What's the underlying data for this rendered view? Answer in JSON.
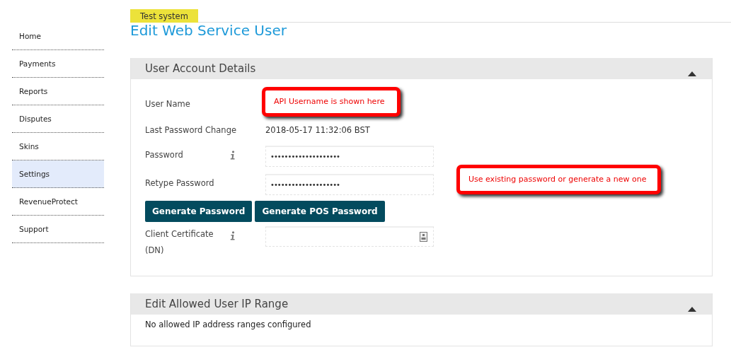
{
  "sidebar": {
    "items": [
      {
        "label": "Home",
        "selected": false
      },
      {
        "label": "Payments",
        "selected": false
      },
      {
        "label": "Reports",
        "selected": false
      },
      {
        "label": "Disputes",
        "selected": false
      },
      {
        "label": "Skins",
        "selected": false
      },
      {
        "label": "Settings",
        "selected": true
      },
      {
        "label": "RevenueProtect",
        "selected": false
      },
      {
        "label": "Support",
        "selected": false
      }
    ]
  },
  "environment_badge": "Test system",
  "page_title": "Edit Web Service User",
  "account_panel": {
    "title": "User Account Details",
    "expanded": true,
    "fields": [
      {
        "kind": "empty",
        "label": "User Name"
      },
      {
        "kind": "text",
        "label": "Last Password Change",
        "value": "2018-05-17 11:32:06 BST"
      },
      {
        "kind": "password",
        "label": "Password",
        "info": true,
        "value": "••••••••••••••••••••"
      },
      {
        "kind": "password",
        "label": "Retype Password",
        "value": "••••••••••••••••••••"
      },
      {
        "kind": "buttons",
        "buttons": [
          "Generate Password",
          "Generate POS Password"
        ]
      },
      {
        "kind": "certificate",
        "label": "Client Certificate (DN)",
        "info": true
      }
    ]
  },
  "ip_panel": {
    "title": "Edit Allowed User IP Range",
    "expanded": true,
    "message": "No allowed IP address ranges configured"
  },
  "callouts": [
    "API Username is shown here",
    "Use existing password or generate a new one"
  ]
}
